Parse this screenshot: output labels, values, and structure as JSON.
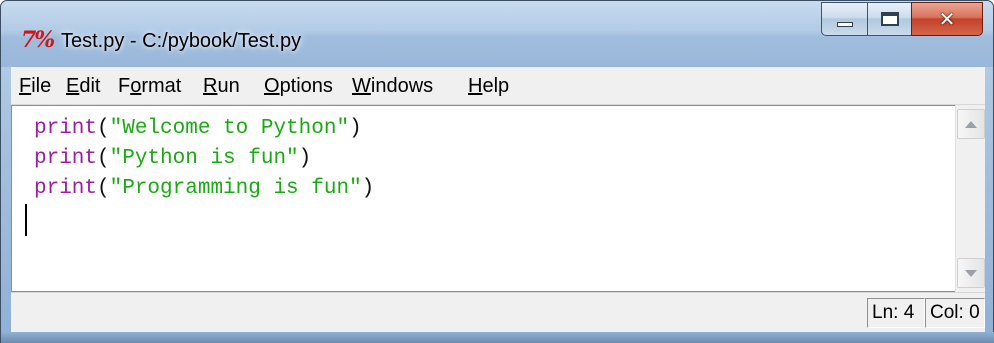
{
  "window": {
    "title": "Test.py - C:/pybook/Test.py",
    "icon": "tk-feather-icon",
    "icon_text": "7%"
  },
  "menubar": {
    "items": [
      {
        "label_u": "F",
        "label_rest": "ile"
      },
      {
        "label_u": "E",
        "label_rest": "dit"
      },
      {
        "label_pre": "F",
        "label_u": "o",
        "label_rest": "rmat"
      },
      {
        "label_u": "R",
        "label_rest": "un"
      },
      {
        "label_u": "O",
        "label_rest": "ptions"
      },
      {
        "label_u": "W",
        "label_rest": "indows"
      },
      {
        "label_u": "H",
        "label_rest": "elp"
      }
    ]
  },
  "editor": {
    "lines": [
      {
        "keyword": "print",
        "open": "(",
        "string": "\"Welcome to Python\"",
        "close": ")"
      },
      {
        "keyword": "print",
        "open": "(",
        "string": "\"Python is fun\"",
        "close": ")"
      },
      {
        "keyword": "print",
        "open": "(",
        "string": "\"Programming is fun\"",
        "close": ")"
      }
    ],
    "colors": {
      "keyword": "#9d1ea3",
      "string": "#1ba914",
      "text": "#111111"
    }
  },
  "statusbar": {
    "line": "Ln: 4",
    "column": "Col: 0"
  },
  "colors": {
    "titlebar": "#b3cbe6",
    "close_button": "#c2422a",
    "menubar": "#f0f0f0"
  }
}
